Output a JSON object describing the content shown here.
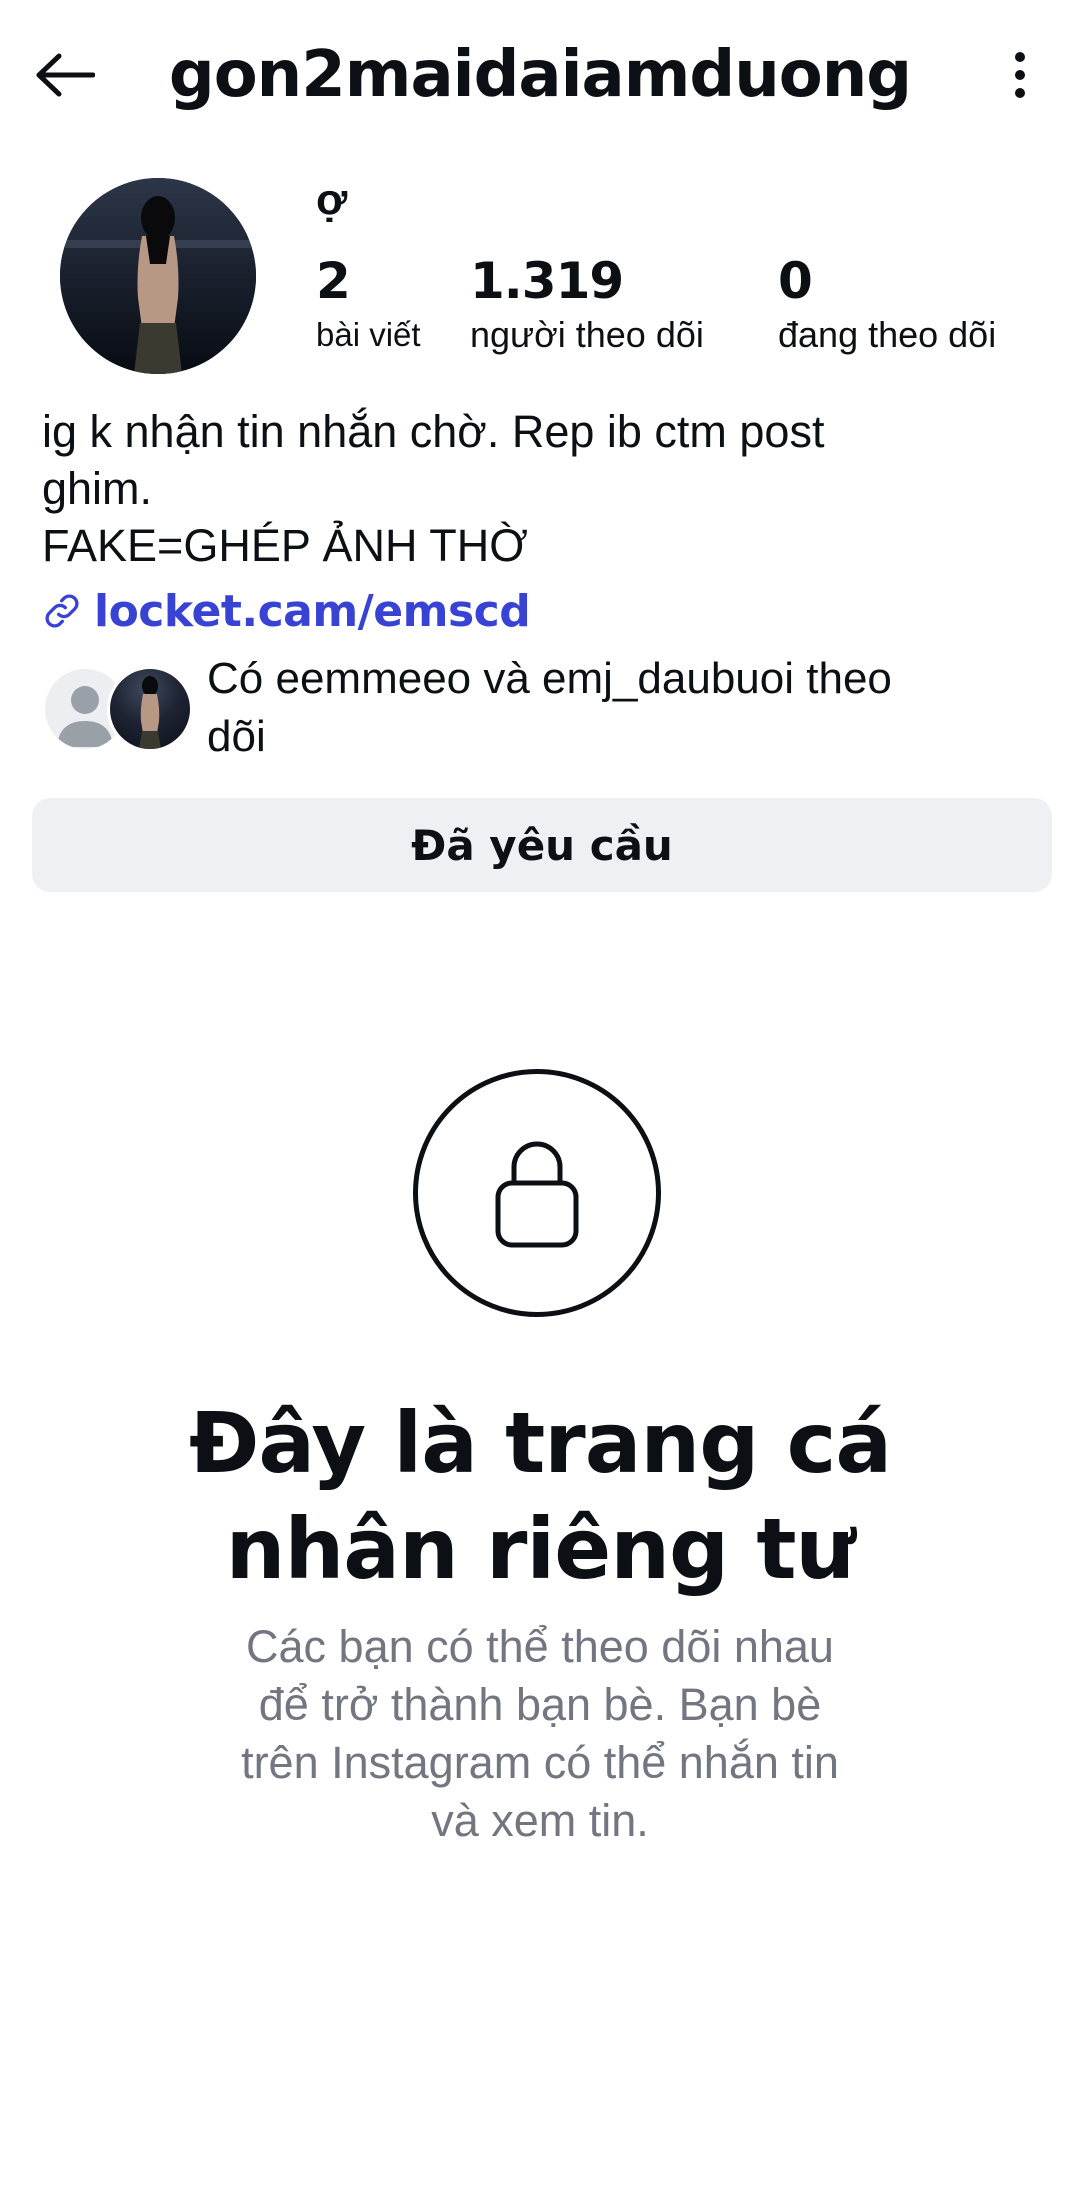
{
  "header": {
    "username": "gon2maidaiamduong",
    "back_icon": "arrow-left-icon",
    "more_icon": "more-vertical-icon"
  },
  "profile": {
    "display_name": "ợ",
    "stats": {
      "posts_count": "2",
      "posts_label": "bài viết",
      "followers_count": "1.319",
      "followers_label": "người theo dõi",
      "following_count": "0",
      "following_label": "đang theo dõi"
    },
    "bio_lines": [
      "ig k nhận tin nhắn chờ. Rep ib ctm post",
      "ghim.",
      "FAKE=GHÉP ẢNH THỜ"
    ],
    "link": "locket.cam/emscd",
    "mutual_followers": {
      "line1": "Có eemmeeo và emj_daubuoi theo",
      "line2": "dõi"
    }
  },
  "actions": {
    "follow_status_label": "Đã yêu cầu"
  },
  "private_notice": {
    "icon": "lock-icon",
    "title_line1": "Đây là trang cá",
    "title_line2": "nhân riêng tư",
    "description_lines": [
      "Các bạn có thể theo dõi nhau",
      "để trở thành bạn bè. Bạn bè",
      "trên Instagram có thể nhắn tin",
      "và xem tin."
    ]
  },
  "colors": {
    "text_primary": "#0c1014",
    "link": "#3843d3",
    "button_bg": "#eff0f4",
    "secondary_text": "#737681"
  }
}
